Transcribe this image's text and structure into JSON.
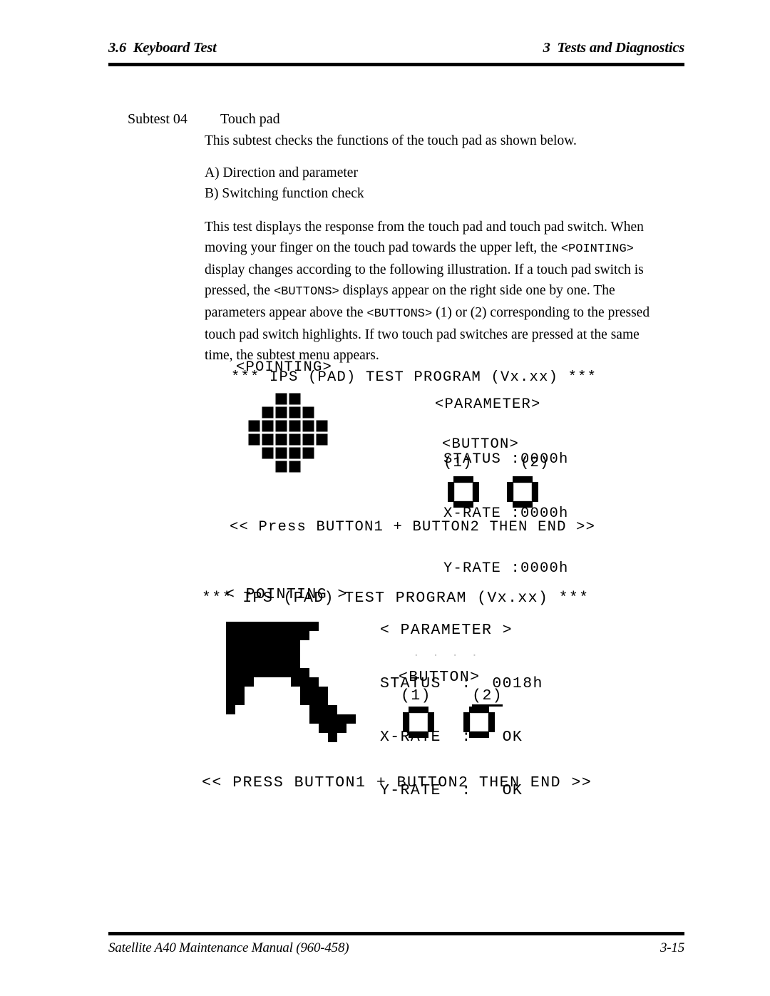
{
  "header": {
    "left": "3.6  Keyboard Test",
    "right": "3  Tests and Diagnostics"
  },
  "subtest": {
    "label": "Subtest 04",
    "title": "Touch pad"
  },
  "body": {
    "intro": "This subtest checks the functions of the touch pad as shown below.",
    "item_a": "A) Direction and parameter",
    "item_b": "B) Switching function check",
    "desc_1": "This test displays the response from the touch pad and touch pad switch. When moving your finger on the touch pad towards the upper left, the ",
    "desc_mono_1": "<POINTING>",
    "desc_2": " display changes according to the following illustration. If a touch pad switch is pressed, the ",
    "desc_mono_2": "<BUTTONS>",
    "desc_3": " displays appear on the right side one by one. The parameters appear above the ",
    "desc_mono_3": "<BUTTONS>",
    "desc_4": " (1) or (2) corresponding to the pressed touch pad switch highlights. If two touch pad switches are pressed at the same time, the subtest menu appears."
  },
  "screen1": {
    "title": "*** IPS (PAD) TEST PROGRAM (Vx.xx) ***",
    "pointing_label": "<POINTING>",
    "parameter_label": "<PARAMETER>",
    "status_line": "STATUS :0000h",
    "xrate_line": "X-RATE :0000h",
    "yrate_line": "Y-RATE :0000h",
    "button_label": "<BUTTON>",
    "button_numbers": "(1)     (2)",
    "footer_line": "<< Press BUTTON1 + BUTTON2 THEN END >>",
    "pointing_grid": [
      [
        0,
        0,
        1,
        1,
        0,
        0
      ],
      [
        0,
        1,
        1,
        1,
        1,
        0
      ],
      [
        1,
        1,
        1,
        1,
        1,
        1
      ],
      [
        1,
        1,
        1,
        1,
        1,
        1
      ],
      [
        0,
        1,
        1,
        1,
        1,
        0
      ],
      [
        0,
        0,
        1,
        1,
        0,
        0
      ]
    ]
  },
  "screen2": {
    "title": "*** IPS (PAD) TEST PROGRAM (Vx.xx) ***",
    "pointing_label": "< POINTING >",
    "parameter_label": "< PARAMETER >",
    "status_line": "STATUS  :  0018h",
    "xrate_line": "X-RATE  :   OK",
    "yrate_line": "Y-RATE  :   OK",
    "ghost_line": ". . . .",
    "button_label": "<BUTTON>",
    "button_number_1": "(1)",
    "button_number_2": "(2)",
    "footer_line": "<< PRESS BUTTON1 + BUTTON2 THEN END >>",
    "pointing_grid": [
      [
        1,
        1,
        1,
        1,
        1,
        1,
        1,
        1,
        1,
        1,
        0,
        0,
        0,
        0
      ],
      [
        1,
        1,
        1,
        1,
        1,
        1,
        1,
        1,
        1,
        0,
        0,
        0,
        0,
        0
      ],
      [
        1,
        1,
        1,
        1,
        1,
        1,
        1,
        1,
        0,
        0,
        0,
        0,
        0,
        0
      ],
      [
        1,
        1,
        1,
        1,
        1,
        1,
        1,
        1,
        0,
        0,
        0,
        0,
        0,
        0
      ],
      [
        1,
        1,
        1,
        1,
        1,
        1,
        1,
        1,
        0,
        0,
        0,
        0,
        0,
        0
      ],
      [
        1,
        1,
        1,
        1,
        1,
        1,
        1,
        1,
        1,
        0,
        0,
        0,
        0,
        0
      ],
      [
        1,
        1,
        1,
        0,
        0,
        0,
        0,
        1,
        1,
        1,
        0,
        0,
        0,
        0
      ],
      [
        1,
        1,
        0,
        0,
        0,
        0,
        0,
        0,
        1,
        1,
        1,
        0,
        0,
        0
      ],
      [
        1,
        1,
        0,
        0,
        0,
        0,
        0,
        0,
        1,
        1,
        1,
        0,
        0,
        0
      ],
      [
        1,
        0,
        0,
        0,
        0,
        0,
        0,
        0,
        0,
        1,
        1,
        1,
        0,
        0
      ],
      [
        0,
        0,
        0,
        0,
        0,
        0,
        0,
        0,
        0,
        1,
        1,
        1,
        1,
        1
      ],
      [
        0,
        0,
        0,
        0,
        0,
        0,
        0,
        0,
        0,
        0,
        1,
        1,
        1,
        0
      ],
      [
        0,
        0,
        0,
        0,
        0,
        0,
        0,
        0,
        0,
        0,
        0,
        1,
        0,
        0
      ]
    ]
  },
  "footer": {
    "left": "Satellite A40 Maintenance Manual (960-458)",
    "right": "3-15"
  }
}
